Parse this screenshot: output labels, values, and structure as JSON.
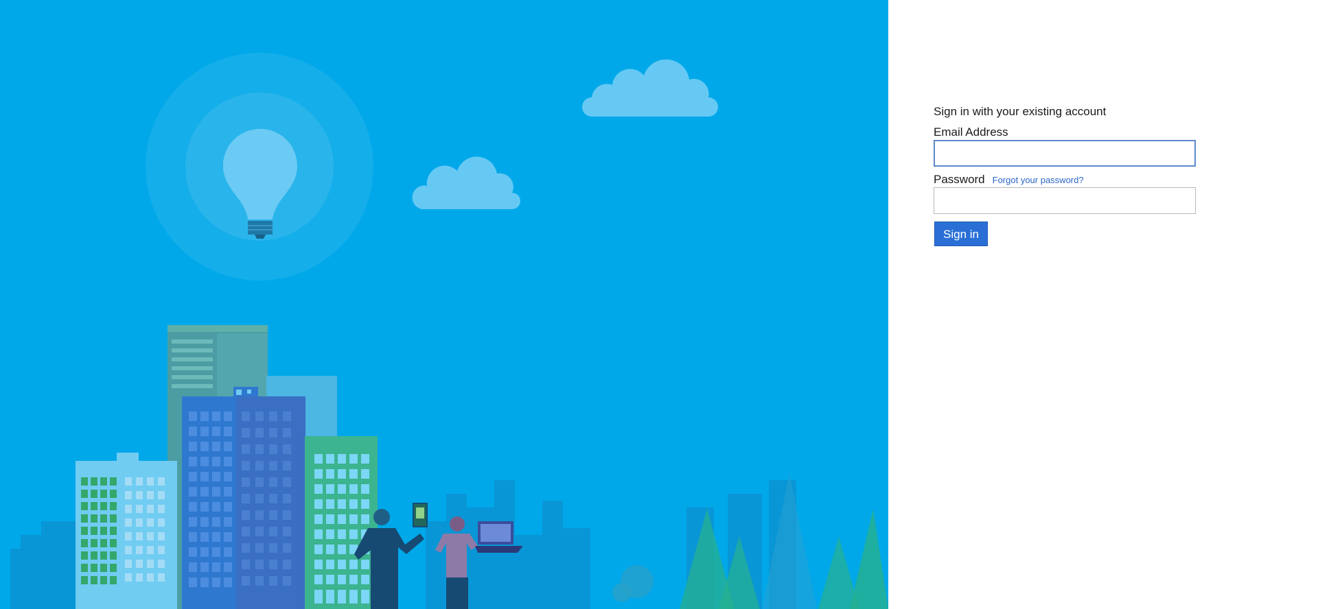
{
  "signin": {
    "heading": "Sign in with your existing account",
    "email_label": "Email Address",
    "email_value": "",
    "password_label": "Password",
    "forgot_link": "Forgot your password?",
    "password_value": "",
    "submit_label": "Sign in"
  },
  "colors": {
    "hero_background": "#00a8e9",
    "button": "#2a6fd6",
    "link": "#2b65c7"
  }
}
